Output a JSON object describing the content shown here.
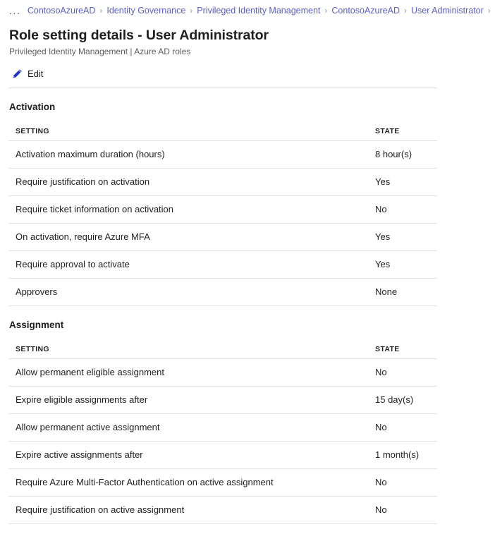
{
  "breadcrumb": {
    "ellipsis": "...",
    "items": [
      "ContosoAzureAD",
      "Identity Governance",
      "Privileged Identity Management",
      "ContosoAzureAD",
      "User Administrator"
    ],
    "separator": "›"
  },
  "header": {
    "title": "Role setting details - User Administrator",
    "subtitle": "Privileged Identity Management | Azure AD roles"
  },
  "toolbar": {
    "edit_label": "Edit",
    "edit_icon": "pencil-icon",
    "icon_color": "#1f35cc"
  },
  "columns": {
    "setting": "SETTING",
    "state": "STATE"
  },
  "sections": [
    {
      "heading": "Activation",
      "rows": [
        {
          "setting": "Activation maximum duration (hours)",
          "state": "8 hour(s)"
        },
        {
          "setting": "Require justification on activation",
          "state": "Yes"
        },
        {
          "setting": "Require ticket information on activation",
          "state": "No"
        },
        {
          "setting": "On activation, require Azure MFA",
          "state": "Yes"
        },
        {
          "setting": "Require approval to activate",
          "state": "Yes"
        },
        {
          "setting": "Approvers",
          "state": "None"
        }
      ]
    },
    {
      "heading": "Assignment",
      "rows": [
        {
          "setting": "Allow permanent eligible assignment",
          "state": "No"
        },
        {
          "setting": "Expire eligible assignments after",
          "state": "15 day(s)"
        },
        {
          "setting": "Allow permanent active assignment",
          "state": "No"
        },
        {
          "setting": "Expire active assignments after",
          "state": "1 month(s)"
        },
        {
          "setting": "Require Azure Multi-Factor Authentication on active assignment",
          "state": "No"
        },
        {
          "setting": "Require justification on active assignment",
          "state": "No"
        }
      ]
    }
  ],
  "colors": {
    "link": "#5c5fc8",
    "separator": "#9a98a0",
    "divider": "#e5e3e1",
    "text": "#201f1e",
    "subtext": "#605e5c"
  }
}
